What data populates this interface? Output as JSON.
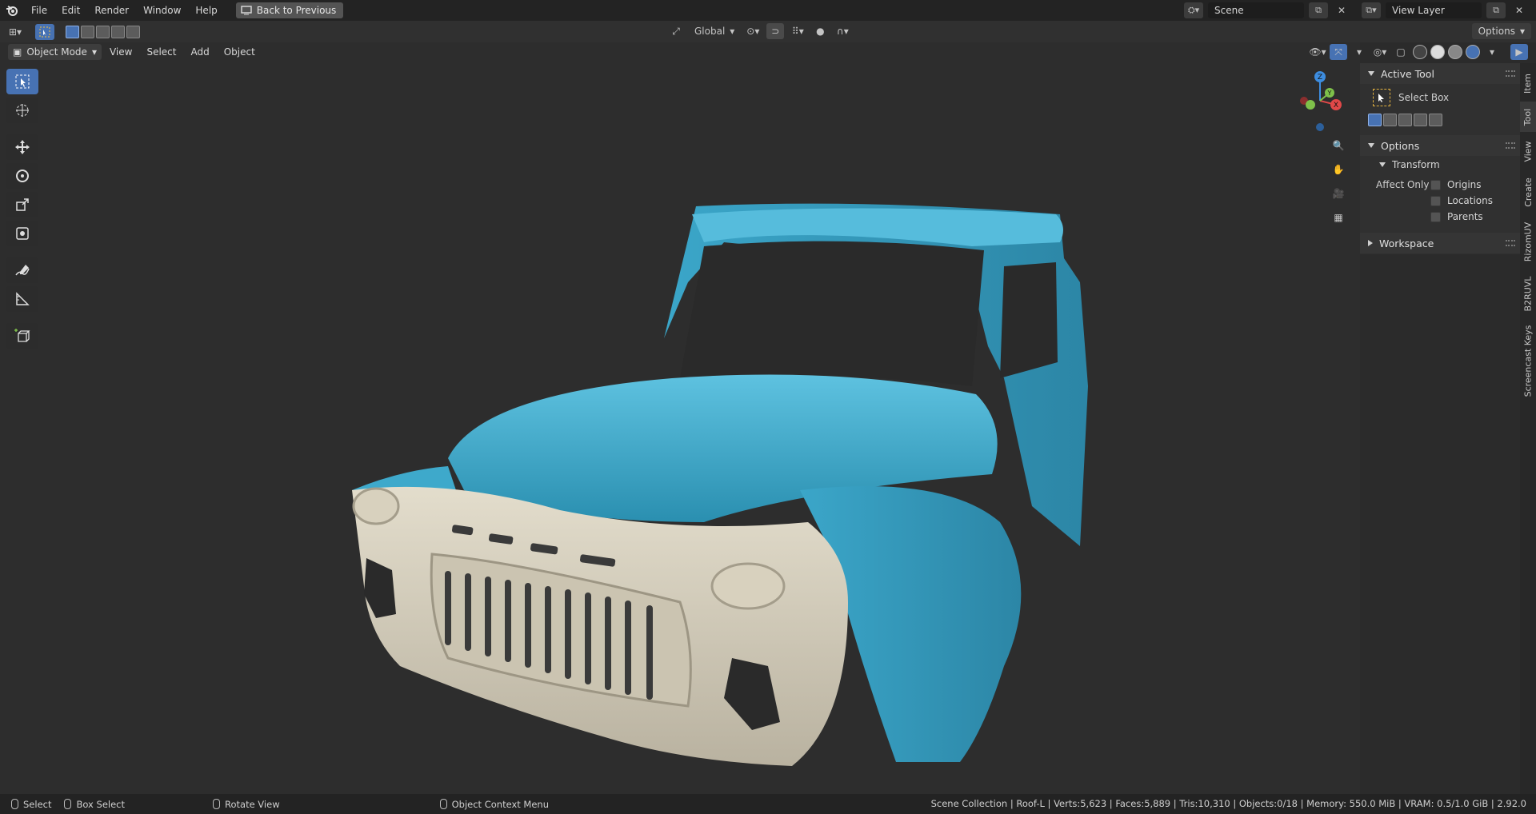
{
  "topbar": {
    "menus": [
      "File",
      "Edit",
      "Render",
      "Window",
      "Help"
    ],
    "back_label": "Back to Previous",
    "scene": "Scene",
    "view_layer": "View Layer"
  },
  "toolheader": {
    "orientation": "Global",
    "options": "Options"
  },
  "viewport_header": {
    "mode": "Object Mode",
    "menus": [
      "View",
      "Select",
      "Add",
      "Object"
    ]
  },
  "npanel": {
    "active_tool_title": "Active Tool",
    "tool_name": "Select Box",
    "options_title": "Options",
    "transform_title": "Transform",
    "affect_only_label": "Affect Only",
    "checks": [
      "Origins",
      "Locations",
      "Parents"
    ],
    "workspace_title": "Workspace"
  },
  "tabs": [
    "Item",
    "Tool",
    "View",
    "Create",
    "RizomUV",
    "B2RUVL",
    "Screencast Keys"
  ],
  "gizmo": {
    "z": "Z",
    "y": "Y",
    "x": "X"
  },
  "statusbar": {
    "select": "Select",
    "box_select": "Box Select",
    "rotate": "Rotate View",
    "context": "Object Context Menu",
    "stats": "Scene Collection | Roof-L | Verts:5,623 | Faces:5,889 | Tris:10,310 | Objects:0/18 | Memory: 550.0 MiB | VRAM: 0.5/1.0 GiB | 2.92.0"
  },
  "colors": {
    "accent": "#4772b3",
    "truck_blue": "#3fa9cc",
    "truck_cream": "#d9d3c2"
  }
}
